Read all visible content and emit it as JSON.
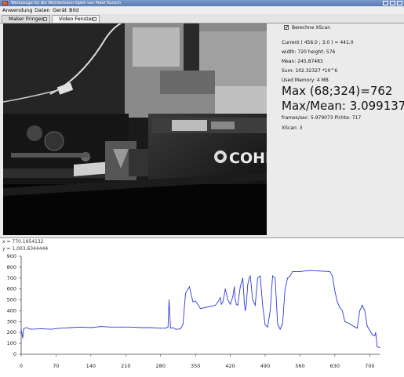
{
  "window": {
    "title": "Werkzeuge für die Wichtelmann-Optik von Peter Kunsch"
  },
  "menu": [
    "Anwendung",
    "Daten",
    "Gerät",
    "Bild"
  ],
  "tabs": [
    {
      "label": "Maker Fringes",
      "active": false
    },
    {
      "label": "Video Fenster",
      "active": true
    }
  ],
  "camera": {
    "brand_text": "COHER"
  },
  "panel": {
    "checkbox_label": "Berechne XScan",
    "checkbox_checked": true,
    "current": "Current ( 456.0 ; 3.0 ) = 441.0",
    "size": "width: 720 height: 576",
    "mean": "Mean: 245.87483",
    "sum": "Sum: 102.32327 *10^6",
    "memory": "Used Memory: 4 MB",
    "max": "Max (68;324)=762",
    "max_mean": "Max/Mean: 3.099137",
    "fps": "frames/sec: 5.979073  Pichte: 717",
    "xscan": "XScan: 3"
  },
  "readout": {
    "x": "x = 770.1954132",
    "y": "y = 1,003.6344444"
  },
  "chart_data": {
    "type": "line",
    "title": "",
    "xlabel": "",
    "ylabel": "",
    "xlim": [
      0,
      720
    ],
    "ylim": [
      0,
      900
    ],
    "x_ticks": [
      0,
      70,
      140,
      210,
      280,
      350,
      420,
      490,
      560,
      630,
      700
    ],
    "y_ticks": [
      0,
      100,
      200,
      300,
      400,
      500,
      600,
      700,
      800,
      900
    ],
    "grid": false,
    "color": "#2b3bd6",
    "series": [
      {
        "x": [
          0,
          3,
          5,
          10,
          20,
          40,
          60,
          80,
          100,
          120,
          140,
          160,
          180,
          200,
          220,
          240,
          260,
          280,
          290,
          295,
          297,
          300,
          305,
          310,
          315,
          320,
          325,
          330,
          335,
          338,
          345,
          350,
          360,
          370,
          380,
          390,
          395,
          400,
          402,
          405,
          408,
          410,
          415,
          420,
          425,
          428,
          430,
          432,
          435,
          440,
          445,
          448,
          450,
          452,
          455,
          458,
          460,
          465,
          470,
          475,
          480,
          485,
          490,
          495,
          500,
          505,
          510,
          515,
          520,
          525,
          530,
          535,
          540,
          545,
          550,
          560,
          580,
          600,
          620,
          625,
          630,
          635,
          640,
          645,
          650,
          660,
          670,
          675,
          680,
          685,
          690,
          695,
          700,
          705,
          710,
          712,
          715,
          720
        ],
        "y": [
          230,
          150,
          235,
          245,
          230,
          235,
          230,
          240,
          245,
          250,
          245,
          255,
          250,
          250,
          250,
          245,
          245,
          240,
          240,
          250,
          500,
          240,
          245,
          230,
          230,
          235,
          275,
          560,
          600,
          620,
          480,
          490,
          420,
          430,
          440,
          450,
          480,
          520,
          460,
          480,
          550,
          600,
          500,
          460,
          530,
          620,
          500,
          460,
          450,
          620,
          700,
          480,
          400,
          450,
          640,
          700,
          720,
          500,
          450,
          700,
          720,
          450,
          270,
          250,
          400,
          720,
          700,
          280,
          230,
          280,
          600,
          700,
          720,
          760,
          760,
          760,
          770,
          765,
          760,
          720,
          580,
          480,
          430,
          400,
          300,
          280,
          250,
          240,
          400,
          450,
          400,
          260,
          220,
          180,
          170,
          200,
          70,
          60
        ]
      }
    ]
  }
}
